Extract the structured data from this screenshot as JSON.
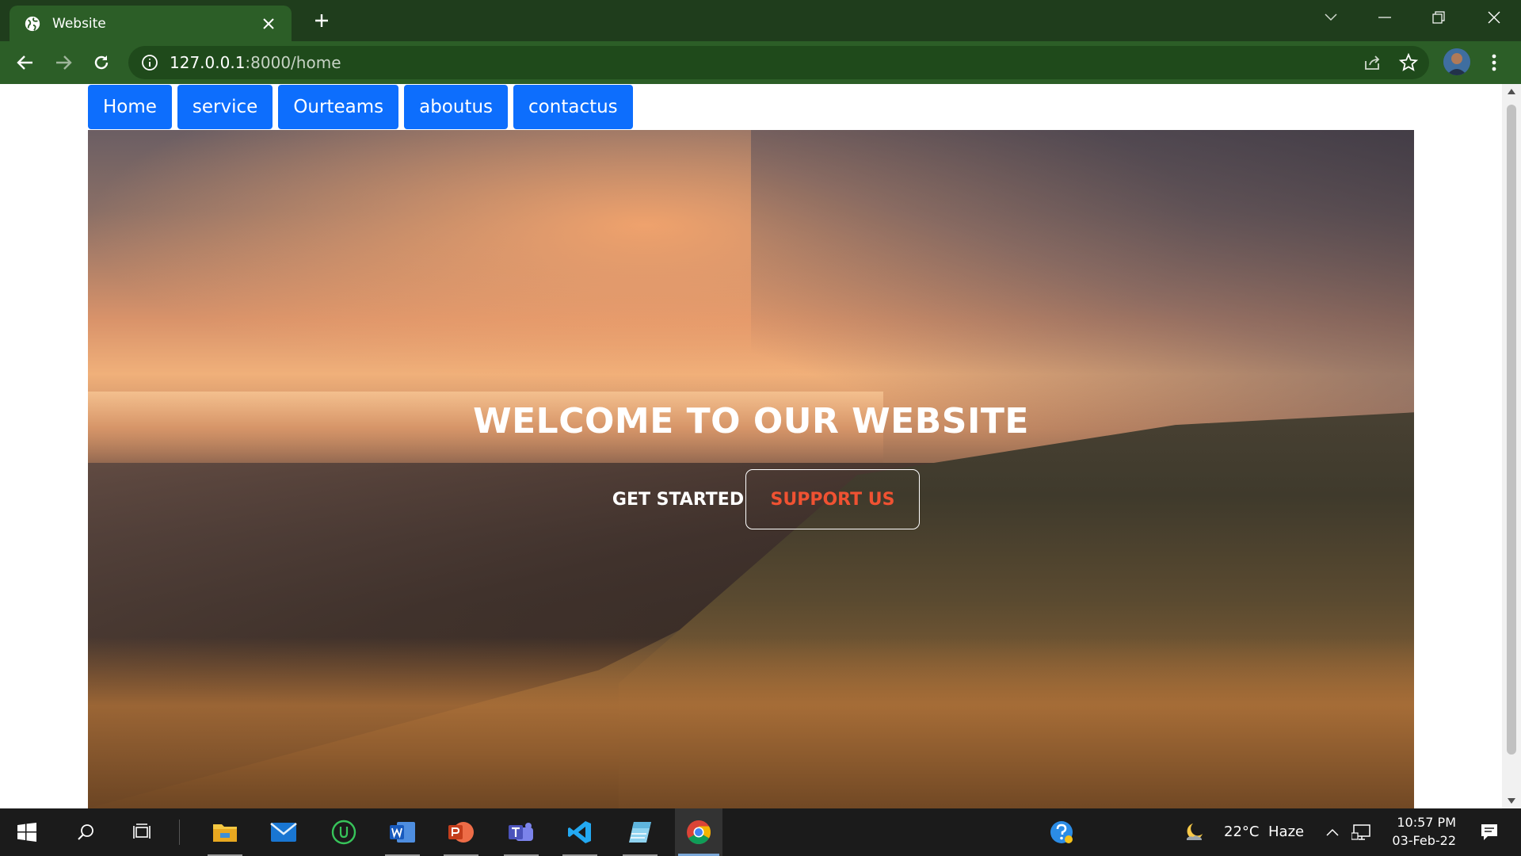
{
  "browser": {
    "tab_title": "Website",
    "url_host": "127.0.0.1",
    "url_path": ":8000/home"
  },
  "site": {
    "nav": [
      "Home",
      "service",
      "Ourteams",
      "aboutus",
      "contactus"
    ],
    "hero_title": "WELCOME TO OUR WEBSITE",
    "get_started_label": "GET STARTED",
    "support_label": "SUPPORT US"
  },
  "taskbar": {
    "weather_temp": "22°C",
    "weather_desc": "Haze",
    "time": "10:57 PM",
    "date": "03-Feb-22",
    "apps": [
      "windows-start",
      "search",
      "task-view",
      "file-explorer",
      "mail",
      "upwork",
      "word",
      "powerpoint",
      "teams",
      "vscode",
      "notepad",
      "chrome"
    ]
  },
  "colors": {
    "chrome_titlebar": "#1f3d1c",
    "chrome_toolbar": "#2c5e27",
    "nav_button": "#0d6efd",
    "support_text": "#f05232"
  }
}
